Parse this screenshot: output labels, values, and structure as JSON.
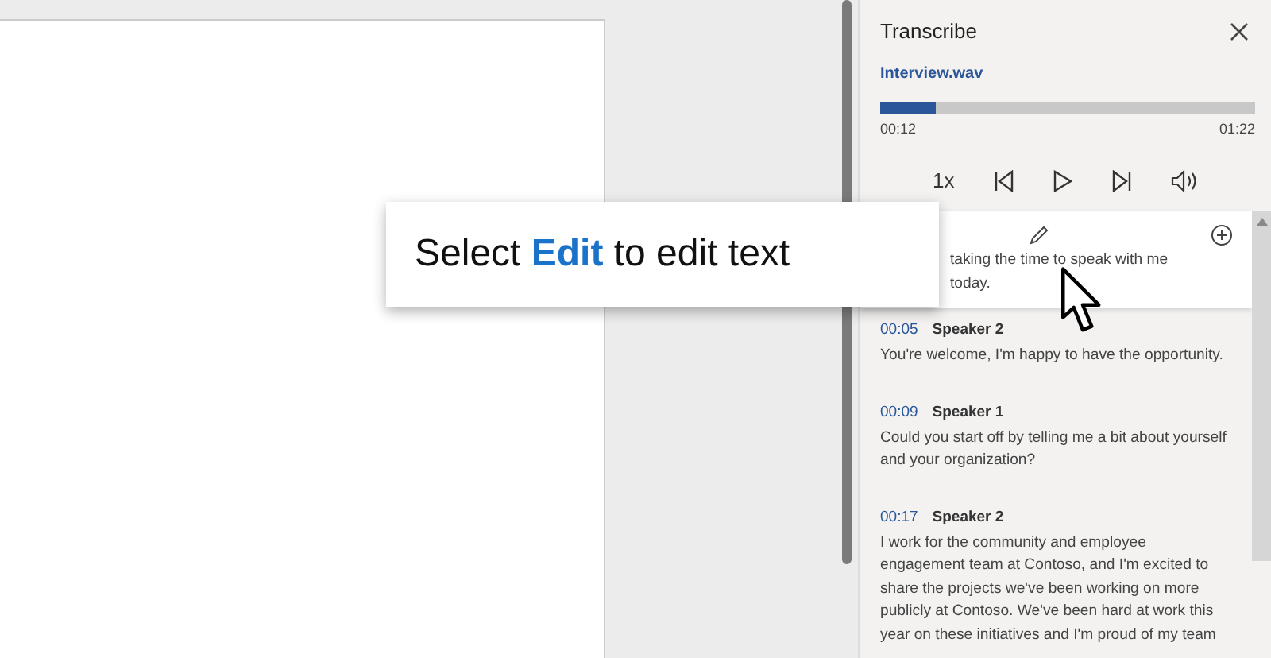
{
  "callout": {
    "text": "Select **Edit** to edit text"
  },
  "panel": {
    "title": "Transcribe",
    "file": "Interview.wav",
    "progress": {
      "level": 0.15,
      "elapsed": "00:12",
      "total": "01:22"
    },
    "speed": "1x"
  },
  "transcript": [
    {
      "text": "taking the time to speak with me today.",
      "selected": true
    },
    {
      "time": "00:05",
      "speaker": "Speaker 2",
      "text": "You're welcome, I'm happy to have the opportunity.",
      "selected": false
    },
    {
      "time": "00:09",
      "speaker": "Speaker 1",
      "text": "Could you start off by telling me a bit about yourself and your organization?",
      "selected": false
    },
    {
      "time": "00:17",
      "speaker": "Speaker 2",
      "text": "I work for the community and employee engagement team at Contoso, and I'm excited to share the projects we've been working on more publicly at Contoso. We've been hard at work this year on these initiatives and I'm proud of my team",
      "selected": false
    }
  ]
}
